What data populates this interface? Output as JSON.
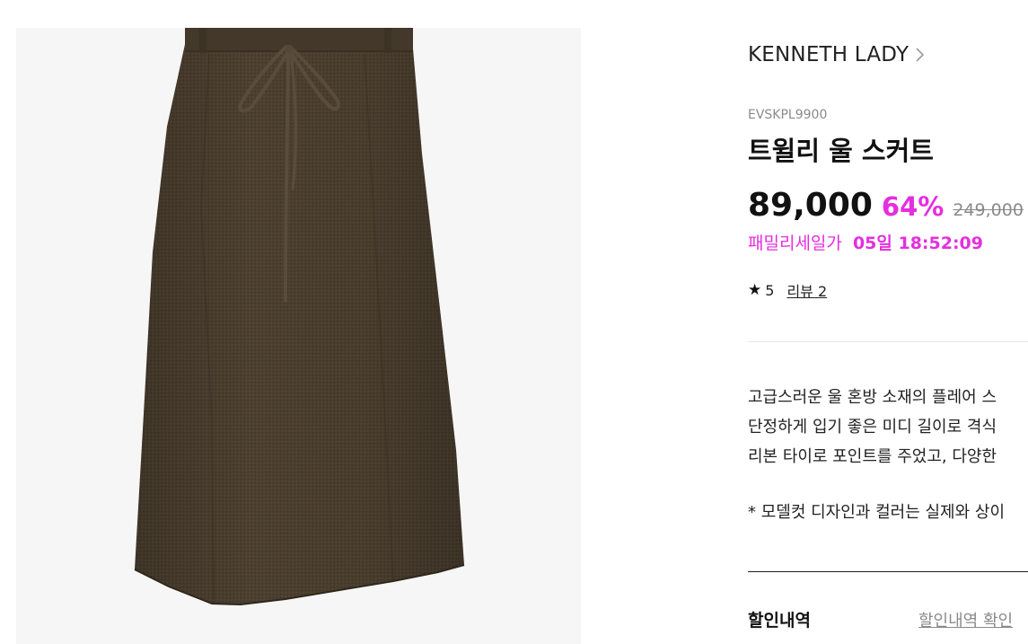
{
  "product": {
    "image_alt": "트윌리 울 스커트 제품 이미지",
    "brand": "KENNETH LADY",
    "code": "EVSKPL9900",
    "title": "트윌리 울 스커트",
    "sale_price": "89,000",
    "discount_rate": "64%",
    "original_price": "249,000",
    "family_sale_label": "패밀리세일가",
    "countdown": "05일 18:52:09",
    "rating_star": "★",
    "rating_value": "5",
    "review_link": "리뷰 2",
    "description_lines": [
      "고급스러운 울 혼방 소재의 플레어 스",
      "단정하게 입기 좋은 미디 길이로 격식",
      "리본 타이로 포인트를 주었고, 다양한"
    ],
    "model_note": "* 모델컷 디자인과 컬러는 실제와 상이",
    "discount_section_label": "할인내역",
    "discount_check_link": "할인내역 확인"
  },
  "colors": {
    "accent_pink": "#e52ee0",
    "text_gray": "#8a8a8a",
    "skirt_brown": "#4a3e2e",
    "image_bg": "#f6f6f6"
  }
}
